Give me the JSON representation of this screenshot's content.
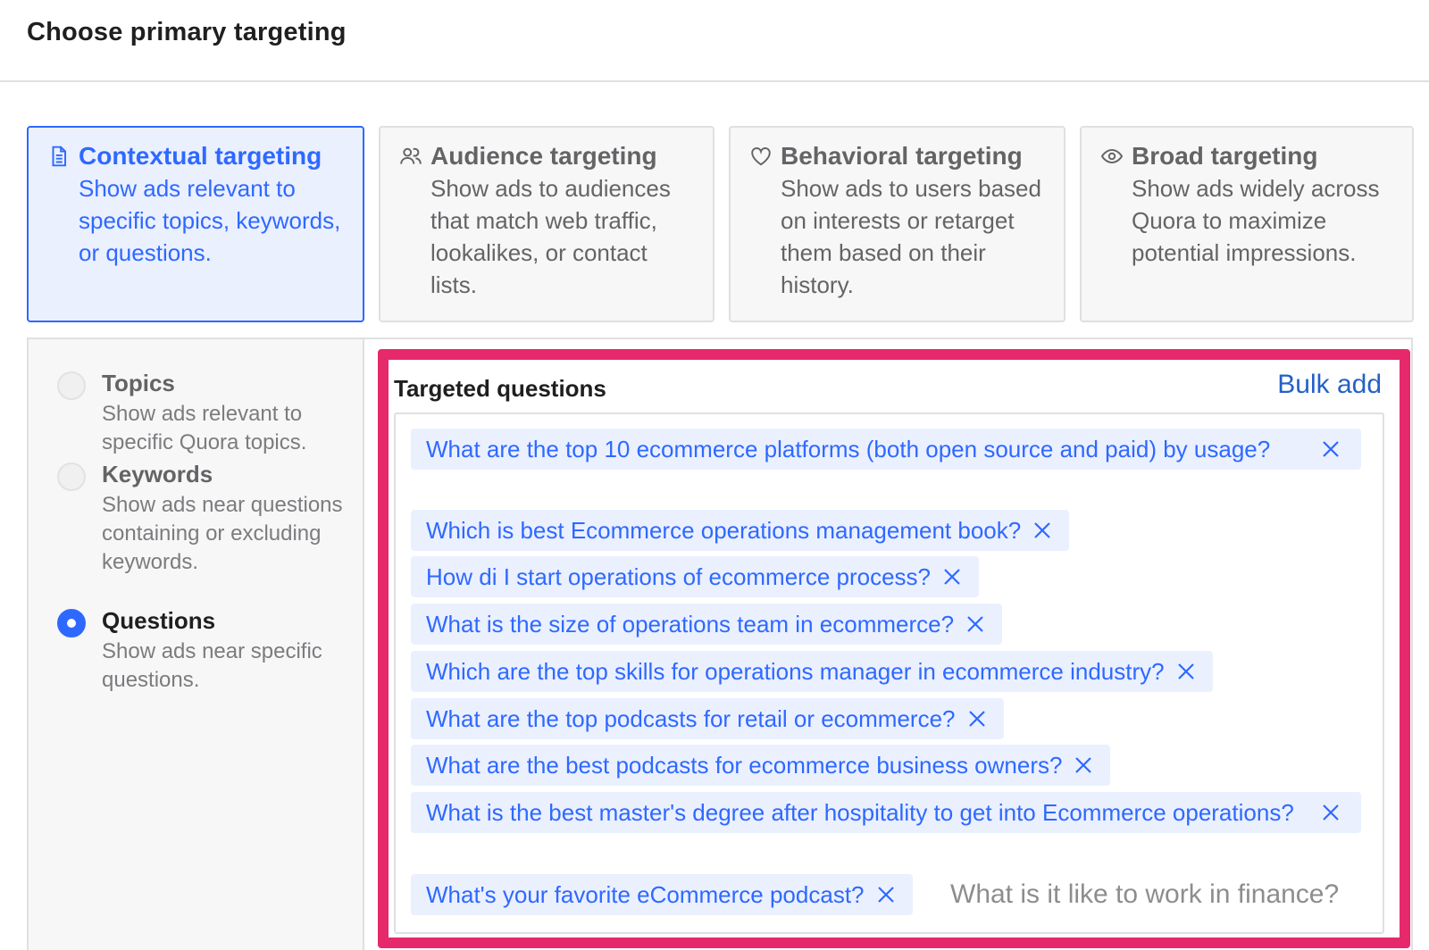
{
  "header": {
    "title": "Choose primary targeting"
  },
  "cards": [
    {
      "title": "Contextual targeting",
      "desc": "Show ads relevant to specific topics, keywords, or questions.",
      "icon": "document-icon"
    },
    {
      "title": "Audience targeting",
      "desc": "Show ads to audiences that match web traffic, lookalikes, or contact lists.",
      "icon": "people-icon"
    },
    {
      "title": "Behavioral targeting",
      "desc": "Show ads to users based on interests or retarget them based on their history.",
      "icon": "heart-icon"
    },
    {
      "title": "Broad targeting",
      "desc": "Show ads widely across Quora to maximize potential impressions.",
      "icon": "eye-icon"
    }
  ],
  "options": [
    {
      "title": "Topics",
      "desc": "Show ads relevant to specific Quora topics.",
      "checked": false
    },
    {
      "title": "Keywords",
      "desc": "Show ads near questions containing or excluding keywords.",
      "checked": false
    },
    {
      "title": "Questions",
      "desc": "Show ads near specific questions.",
      "checked": true
    }
  ],
  "targeted": {
    "title": "Targeted questions",
    "bulk_add": "Bulk add",
    "input_placeholder": "What is it like to work in finance?",
    "questions": [
      "What are the top 10 ecommerce platforms (both open source and paid) by usage?",
      "Which is best Ecommerce operations management book?",
      "How di I start operations of ecommerce process?",
      "What is the size of operations team in ecommerce?",
      "Which are the top skills for operations manager in ecommerce industry?",
      "What are the top podcasts for retail or ecommerce?",
      "What are the best podcasts for ecommerce business owners?",
      "What is the best master's degree after hospitality to get into Ecommerce operations?",
      "What's your favorite eCommerce podcast?"
    ]
  },
  "colors": {
    "accent": "#2e69ff",
    "highlight": "#e6296b",
    "link": "#2461c6"
  }
}
